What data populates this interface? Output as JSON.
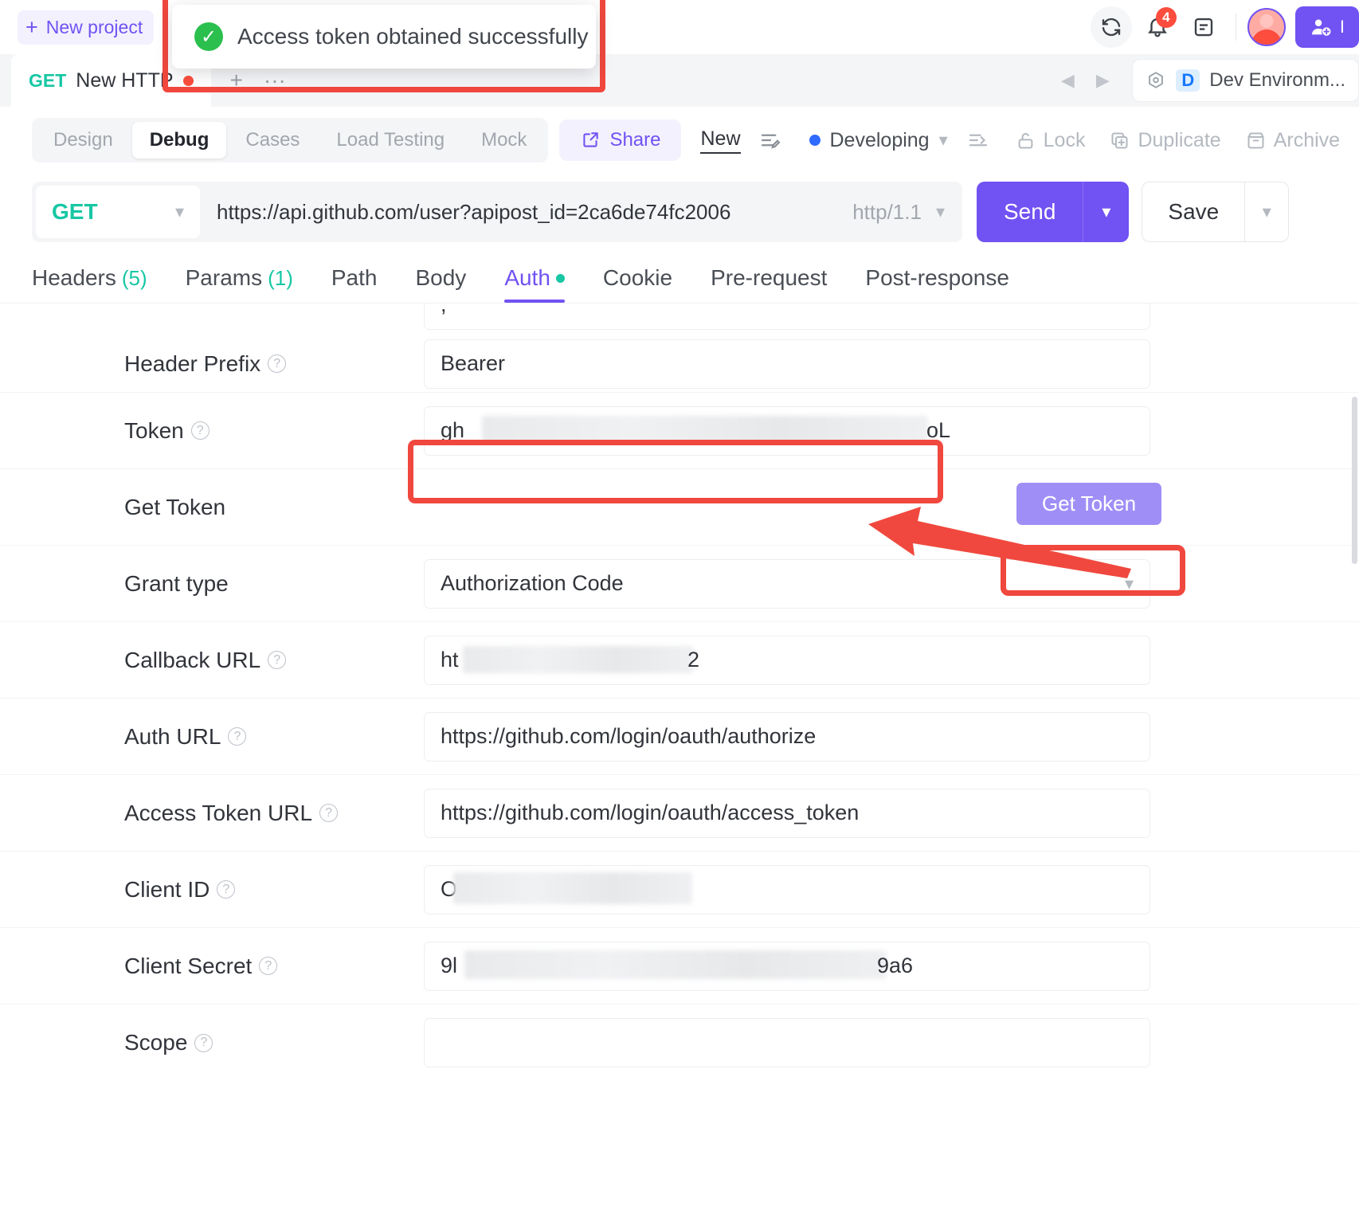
{
  "topbar": {
    "new_project_label": "New project",
    "plus_glyph": "+",
    "icons": [
      "refresh-icon",
      "bell-icon",
      "notes-icon"
    ],
    "notification_count": "4",
    "invite_label": "I"
  },
  "tabstrip": {
    "request_tab": {
      "method": "GET",
      "name": "New HTTP",
      "unsaved": true
    },
    "add_glyph": "+",
    "more_glyph": "···",
    "environment": {
      "tag": "D",
      "name": "Dev Environm..."
    }
  },
  "subbar": {
    "segments": [
      {
        "label": "Design",
        "active": false
      },
      {
        "label": "Debug",
        "active": true
      },
      {
        "label": "Cases",
        "active": false
      },
      {
        "label": "Load Testing",
        "active": false
      },
      {
        "label": "Mock",
        "active": false
      }
    ],
    "share_label": "Share",
    "new_label": "New",
    "status_label": "Developing",
    "actions": [
      {
        "label": "Lock",
        "icon": "lock-icon"
      },
      {
        "label": "Duplicate",
        "icon": "duplicate-icon"
      },
      {
        "label": "Archive",
        "icon": "archive-icon"
      }
    ]
  },
  "urlrow": {
    "method": "GET",
    "url": "https://api.github.com/user?apipost_id=2ca6de74fc2006",
    "protocol": "http/1.1",
    "send_label": "Send",
    "save_label": "Save"
  },
  "request_tabs": [
    {
      "label": "Headers",
      "count": "(5)",
      "active": false,
      "dot": false
    },
    {
      "label": "Params",
      "count": "(1)",
      "active": false,
      "dot": false
    },
    {
      "label": "Path",
      "count": "",
      "active": false,
      "dot": false
    },
    {
      "label": "Body",
      "count": "",
      "active": false,
      "dot": false
    },
    {
      "label": "Auth",
      "count": "",
      "active": true,
      "dot": true
    },
    {
      "label": "Cookie",
      "count": "",
      "active": false,
      "dot": false
    },
    {
      "label": "Pre-request",
      "count": "",
      "active": false,
      "dot": false
    },
    {
      "label": "Post-response",
      "count": "",
      "active": false,
      "dot": false
    }
  ],
  "auth_form": {
    "partial_top_value": ",",
    "fields": [
      {
        "label": "Header Prefix",
        "help": true,
        "value": "Bearer",
        "type": "text",
        "redacted": false
      },
      {
        "label": "Token",
        "help": true,
        "value": "gh",
        "value_tail": "oL",
        "type": "text",
        "redacted": true
      },
      {
        "label": "Get Token",
        "help": false,
        "value": "",
        "type": "button",
        "button_label": "Get Token"
      },
      {
        "label": "Grant type",
        "help": false,
        "value": "Authorization Code",
        "type": "select",
        "redacted": false
      },
      {
        "label": "Callback URL",
        "help": true,
        "value": "ht",
        "value_tail": "2",
        "type": "text",
        "redacted": true
      },
      {
        "label": "Auth URL",
        "help": true,
        "value": "https://github.com/login/oauth/authorize",
        "type": "text",
        "redacted": false
      },
      {
        "label": "Access Token URL",
        "help": true,
        "value": "https://github.com/login/oauth/access_token",
        "type": "text",
        "redacted": false
      },
      {
        "label": "Client ID",
        "help": true,
        "value": "O",
        "value_tail": "",
        "type": "text",
        "redacted": true
      },
      {
        "label": "Client Secret",
        "help": true,
        "value": "9l",
        "value_tail": "9a6",
        "type": "text",
        "redacted": true
      },
      {
        "label": "Scope",
        "help": true,
        "value": "",
        "type": "text",
        "redacted": false
      }
    ]
  },
  "toast": {
    "message": "Access token obtained successfully",
    "icon": "check-circle-icon",
    "check_glyph": "✓"
  },
  "annotations": {
    "highlight_color": "#f0483e",
    "boxes": [
      "toast-highlight",
      "token-field-highlight",
      "get-token-button-highlight"
    ],
    "arrow": "pointer-arrow-to-token"
  },
  "colors": {
    "accent": "#7152f3",
    "method_get": "#17c7a4",
    "annotation": "#f0483e",
    "success": "#2bbf4e",
    "status_dot": "#2f6bff"
  }
}
